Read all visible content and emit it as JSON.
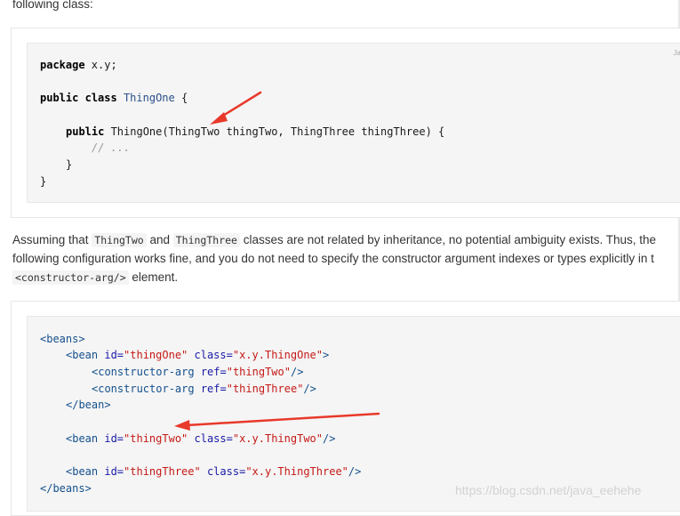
{
  "intro_text": "following class:",
  "code1": {
    "lang_badge": "Ja",
    "package_kw": "package",
    "package_name": " x.y;",
    "public_kw": "public",
    "class_kw": "class",
    "class_name": "ThingOne",
    "brace_open": " {",
    "ctor_public": "public",
    "ctor_sig": " ThingOne(ThingTwo thingTwo, ThingThree thingThree) {",
    "comment": "// ...",
    "inner_close": "}",
    "outer_close": "}"
  },
  "para": {
    "line1_a": "Assuming that ",
    "line1_code1": "ThingTwo",
    "line1_b": " and ",
    "line1_code2": "ThingThree",
    "line1_c": " classes are not related by inheritance, no potential ambiguity exists. Thus, the",
    "line2": "following configuration works fine, and you do not need to specify the constructor argument indexes or types explicitly in t",
    "line3_code": "<constructor-arg/>",
    "line3_b": " element."
  },
  "code2": {
    "beans_open": "<beans>",
    "bean_tag": "<bean",
    "id_attr": " id=",
    "class_attr": " class=",
    "ref_attr": " ref=",
    "bean1_id": "\"thingOne\"",
    "bean1_class": "\"x.y.ThingOne\"",
    "tag_end": ">",
    "self_close": "/>",
    "ctor_tag": "<constructor-arg",
    "ref1": "\"thingTwo\"",
    "ref2": "\"thingThree\"",
    "bean_close": "</bean>",
    "bean2_id": "\"thingTwo\"",
    "bean2_class": "\"x.y.ThingTwo\"",
    "bean3_id": "\"thingThree\"",
    "bean3_class": "\"x.y.ThingThree\"",
    "beans_close": "</beans>"
  },
  "watermark": "https://blog.csdn.net/java_eehehe",
  "colors": {
    "annotation_arrow": "#e8392a"
  }
}
